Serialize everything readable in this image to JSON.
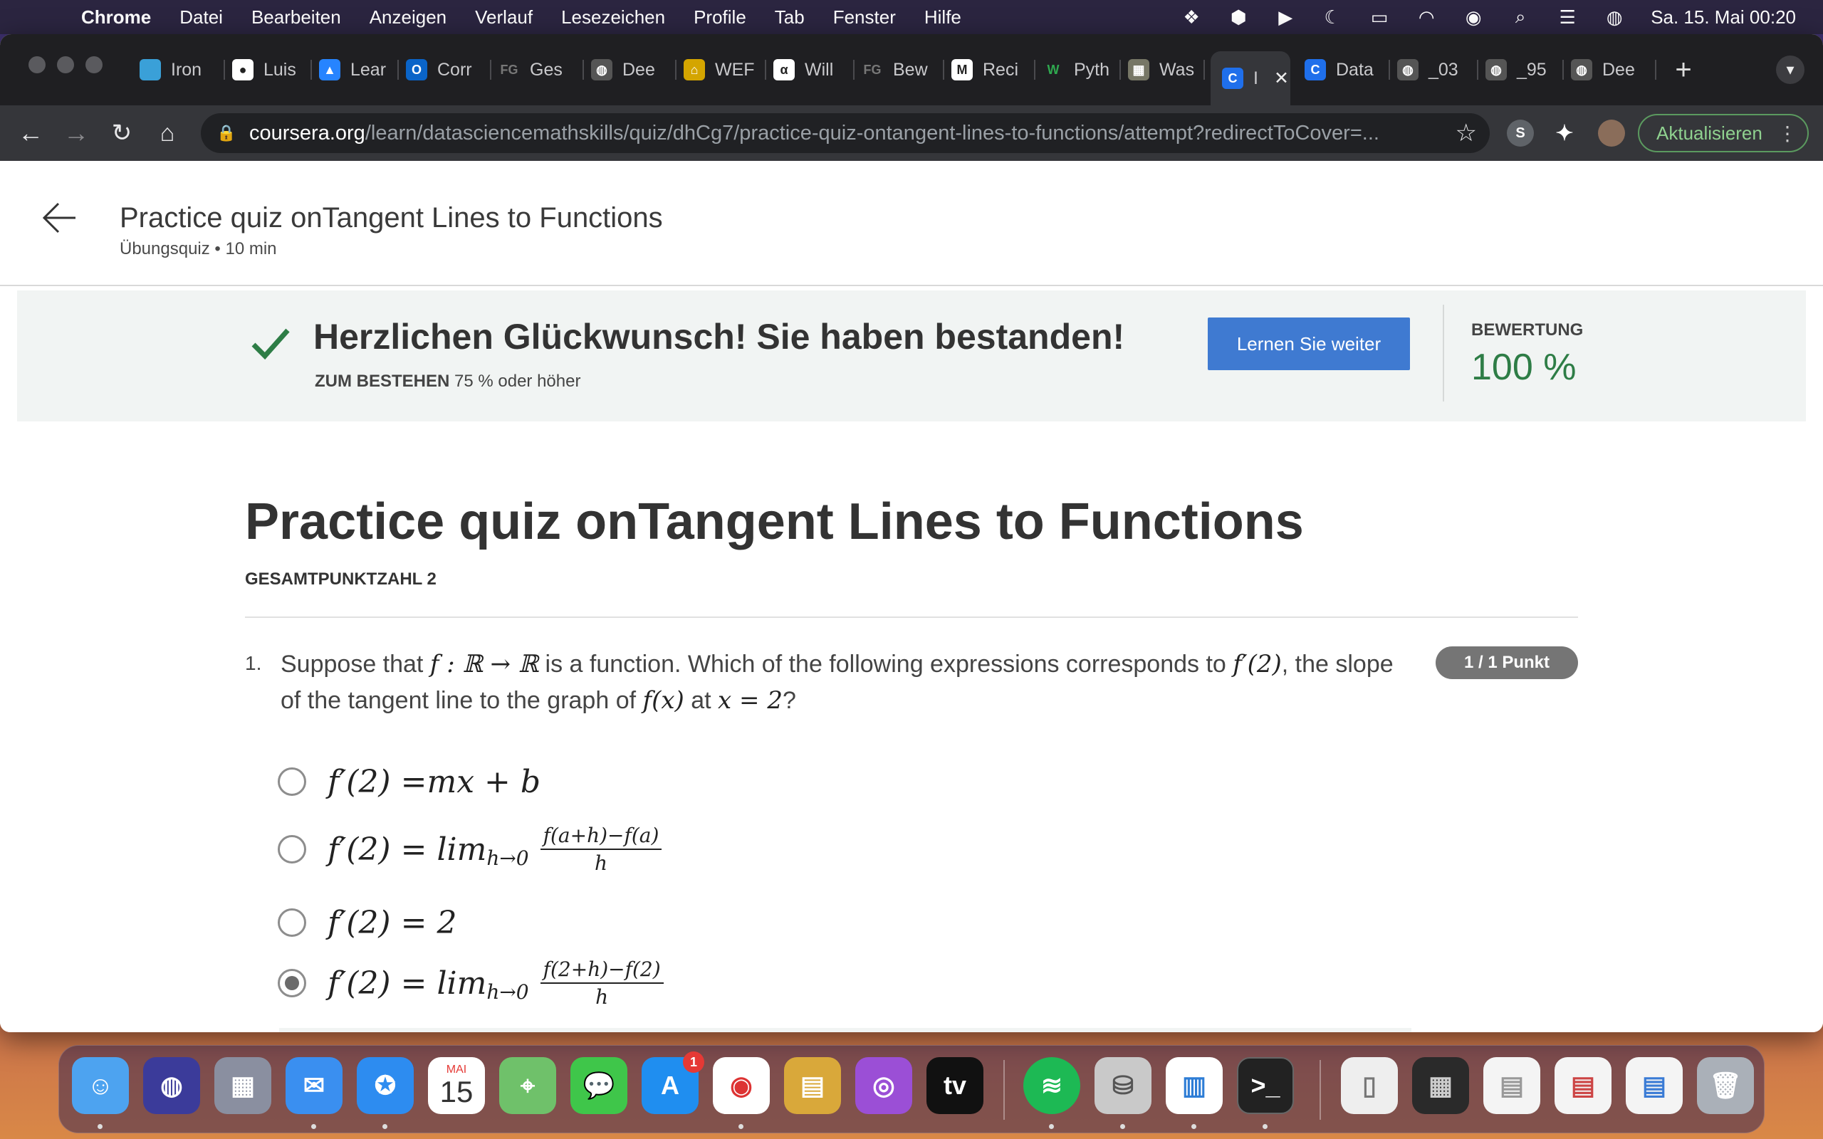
{
  "menubar": {
    "app": "Chrome",
    "items": [
      "Datei",
      "Bearbeiten",
      "Anzeigen",
      "Verlauf",
      "Lesezeichen",
      "Profile",
      "Tab",
      "Fenster",
      "Hilfe"
    ],
    "clock": "Sa. 15. Mai  00:20"
  },
  "tabs": [
    {
      "title": "Iron",
      "icon": "ironhack-icon"
    },
    {
      "title": "Luis",
      "icon": "github-icon"
    },
    {
      "title": "Lear",
      "icon": "atlassian-icon"
    },
    {
      "title": "Corr",
      "icon": "outlook-icon"
    },
    {
      "title": "Ges",
      "icon": "fg-icon"
    },
    {
      "title": "Dee",
      "icon": "globe-icon"
    },
    {
      "title": "WEF",
      "icon": "bank-icon"
    },
    {
      "title": "Will",
      "icon": "wolfram-icon"
    },
    {
      "title": "Bew",
      "icon": "fg-icon"
    },
    {
      "title": "Reci",
      "icon": "gmail-icon"
    },
    {
      "title": "Pyth",
      "icon": "w3-icon"
    },
    {
      "title": "Was",
      "icon": "image-icon"
    },
    {
      "title": "I",
      "icon": "coursera-icon",
      "active": true
    },
    {
      "title": "Data",
      "icon": "coursera-icon"
    },
    {
      "title": "_03",
      "icon": "globe-icon"
    },
    {
      "title": "_95",
      "icon": "globe-icon"
    },
    {
      "title": "Dee",
      "icon": "globe-icon"
    }
  ],
  "address": {
    "domain": "coursera.org",
    "path": "/learn/datasciencemathskills/quiz/dhCg7/practice-quiz-ontangent-lines-to-functions/attempt?redirectToCover=..."
  },
  "update_label": "Aktualisieren",
  "header": {
    "title": "Practice quiz onTangent Lines to Functions",
    "subtitle": "Übungsquiz • 10 min"
  },
  "banner": {
    "message": "Herzlichen Glückwunsch! Sie haben bestanden!",
    "pass_label": "ZUM BESTEHEN",
    "pass_value": "75 % oder höher",
    "continue_label": "Lernen Sie weiter",
    "grade_label": "BEWERTUNG",
    "grade_value": "100 %",
    "accent": "#2e7d46"
  },
  "quiz": {
    "title": "Practice quiz onTangent Lines to Functions",
    "total": "GESAMTPUNKTZAHL 2",
    "question": {
      "number": "1.",
      "text_a": "Suppose that ",
      "math_a": "f : ℝ → ℝ",
      "text_b": " is a function. Which of the following expressions corresponds to ",
      "math_b": "f′(2)",
      "text_c": ", the slope of the tangent line to the graph of ",
      "math_c": "f(x)",
      "text_d": " at ",
      "math_d": "x = 2",
      "text_e": "?",
      "score": "1 / 1 Punkt",
      "options": [
        {
          "lhs": "f′(2) = ",
          "rhs": "mx + b",
          "checked": false
        },
        {
          "lhs": "f′(2) = lim",
          "sub": "h→0",
          "num": "f(a+h)−f(a)",
          "den": "h",
          "checked": false
        },
        {
          "lhs": "f′(2) = 2",
          "checked": false
        },
        {
          "lhs": "f′(2) = lim",
          "sub": "h→0",
          "num": "f(2+h)−f(2)",
          "den": "h",
          "checked": true
        }
      ]
    }
  },
  "dock": {
    "calendar_month": "MAI",
    "calendar_day": "15",
    "appstore_badge": "1"
  }
}
